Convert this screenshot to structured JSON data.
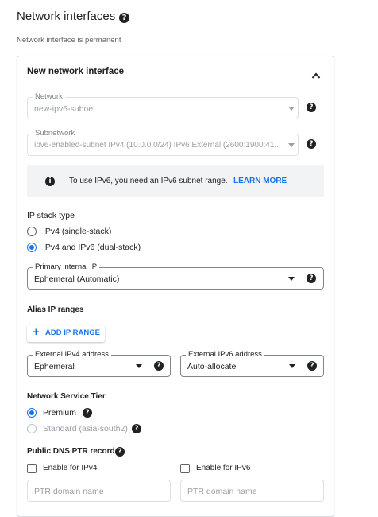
{
  "section": {
    "title": "Network interfaces",
    "permanent_note": "Network interface is permanent"
  },
  "card": {
    "title": "New network interface",
    "collapse_icon": "chevron-up-icon"
  },
  "network": {
    "label": "Network",
    "value": "new-ipv6-subnet"
  },
  "subnetwork": {
    "label": "Subnetwork",
    "value": "ipv6-enabled-subnet IPv4 (10.0.0.0/24)  IPv6 External (2600:1900:41..."
  },
  "info": {
    "icon": "info-icon",
    "text": "To use IPv6, you need an IPv6 subnet range.",
    "link": "LEARN MORE"
  },
  "ip_stack": {
    "title": "IP stack type",
    "options": [
      "IPv4 (single-stack)",
      "IPv4 and IPv6 (dual-stack)"
    ],
    "selected": "IPv4 and IPv6 (dual-stack)"
  },
  "primary_ip": {
    "label": "Primary internal IP",
    "value": "Ephemeral (Automatic)"
  },
  "alias": {
    "title": "Alias IP ranges",
    "add_button": "ADD IP RANGE"
  },
  "external_ipv4": {
    "label": "External IPv4 address",
    "value": "Ephemeral"
  },
  "external_ipv6": {
    "label": "External IPv6 address",
    "value": "Auto-allocate"
  },
  "tier": {
    "title": "Network Service Tier",
    "options": [
      "Premium",
      "Standard (asia-south2)"
    ],
    "selected": "Premium"
  },
  "ptr": {
    "title": "Public DNS PTR record",
    "ipv4_checkbox": "Enable for IPv4",
    "ipv6_checkbox": "Enable for IPv6",
    "ipv4_placeholder": "PTR domain name",
    "ipv6_placeholder": "PTR domain name"
  },
  "colors": {
    "accent": "#1a73e8",
    "info_bg": "#f1f3f4",
    "border": "#dadce0"
  }
}
